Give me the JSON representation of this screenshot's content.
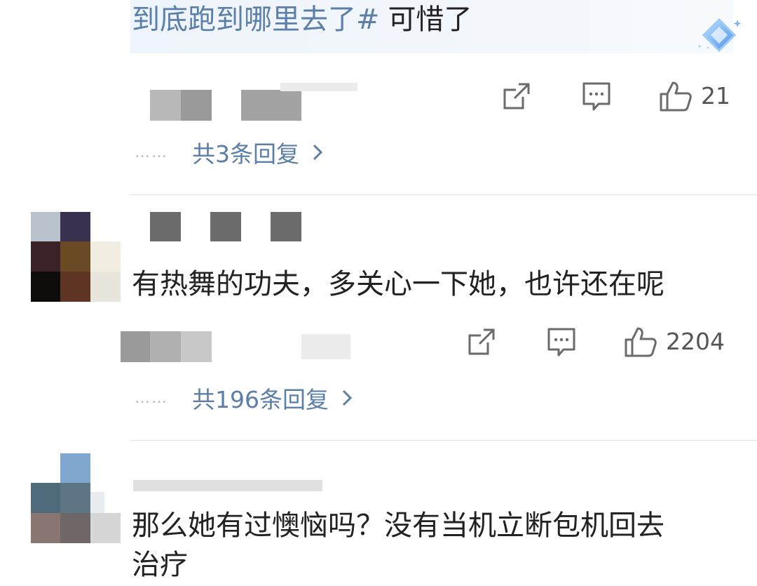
{
  "comments": [
    {
      "text_link": "到底跑到哪里去了#",
      "text_rest": "可惜了",
      "likes": "21",
      "replies_label": "共3条回复",
      "replies_dots": "……"
    },
    {
      "text": "有热舞的功夫，多关心一下她，也许还在呢",
      "likes": "2204",
      "replies_label": "共196条回复",
      "replies_dots": "……"
    },
    {
      "text_line1": "那么她有过懊恼吗？没有当机立断包机回去",
      "text_line2": "治疗"
    }
  ],
  "icons": {
    "share": "share-icon",
    "comment": "comment-icon",
    "like": "thumbs-up-icon",
    "chevron": "chevron-right-icon",
    "badge": "diamond-badge-icon"
  },
  "colors": {
    "link": "#5b7fa8",
    "text": "#222222",
    "muted": "#555555",
    "divider": "#e3e3e3"
  }
}
